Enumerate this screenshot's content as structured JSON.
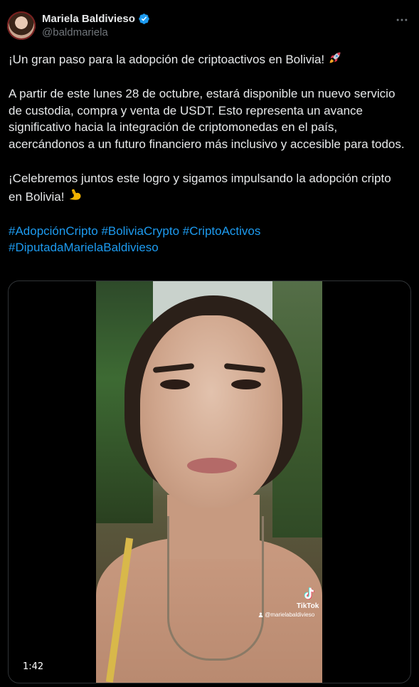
{
  "author": {
    "display_name": "Mariela Baldivieso",
    "handle": "@baldmariela",
    "verified": true,
    "verified_color": "#1d9bf0"
  },
  "tweet": {
    "line1": "¡Un gran paso para la adopción de criptoactivos en Bolivia!",
    "line1_emoji": "rocket",
    "paragraph2": "A partir de este lunes 28 de octubre, estará disponible un nuevo servicio de custodia, compra y venta de USDT. Esto representa un avance significativo hacia la integración de criptomonedas en el país, acercándonos a un futuro financiero más inclusivo y accesible para todos.",
    "paragraph3": "¡Celebremos juntos este logro y sigamos impulsando la adopción cripto en Bolivia!",
    "paragraph3_emoji": "flexed-biceps",
    "hashtags": [
      "#AdopciónCripto",
      "#BoliviaCrypto",
      "#CriptoActivos",
      "#DiputadaMarielaBaldivieso"
    ],
    "hashtag_color": "#1d9bf0"
  },
  "media": {
    "type": "video",
    "duration": "1:42",
    "watermark_label": "TikTok",
    "watermark_user": "@marielabaldivieso"
  },
  "colors": {
    "background": "#000000",
    "text": "#e7e9ea",
    "secondary": "#71767b",
    "border": "#2f3336"
  }
}
